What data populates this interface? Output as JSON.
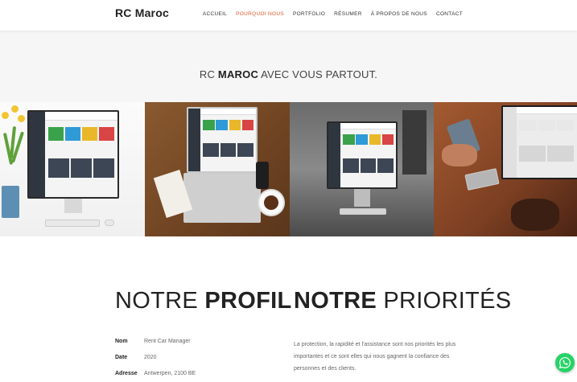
{
  "brand": "RC Maroc",
  "nav": [
    {
      "label": "ACCUEIL",
      "active": false
    },
    {
      "label": "POURQUOI NOUS",
      "active": true
    },
    {
      "label": "PORTFOLIO",
      "active": false
    },
    {
      "label": "RÉSUMER",
      "active": false
    },
    {
      "label": "À PROPOS DE NOUS",
      "active": false
    },
    {
      "label": "CONTACT",
      "active": false
    }
  ],
  "hero": {
    "tagline_prefix": "RC ",
    "tagline_bold": "MAROC",
    "tagline_suffix": " AVEC VOUS PARTOUT."
  },
  "gallery": [
    {
      "name": "imac-dashboard-photo"
    },
    {
      "name": "laptop-wooden-desk-photo"
    },
    {
      "name": "imac-office-bw-photo"
    },
    {
      "name": "laptop-hands-phone-photo"
    }
  ],
  "profil": {
    "title_light": "NOTRE ",
    "title_bold": "PROFIL",
    "rows": [
      {
        "key": "Nom",
        "value": "Rent Car Manager"
      },
      {
        "key": "Date",
        "value": "2020"
      },
      {
        "key": "Adresse",
        "value": "Antwerpen, 2100 BE"
      }
    ]
  },
  "priorites": {
    "title_bold": "NOTRE",
    "title_light": " PRIORITÉS",
    "text": "La protection, la rapidité et l'assistance sont nos priorités les plus importantes et ce sont elles qui nous gagnent la confiance des personnes et des clients."
  },
  "colors": {
    "accent": "#e05b2c",
    "whatsapp": "#25d366"
  },
  "icons": {
    "whatsapp": "whatsapp-icon"
  }
}
